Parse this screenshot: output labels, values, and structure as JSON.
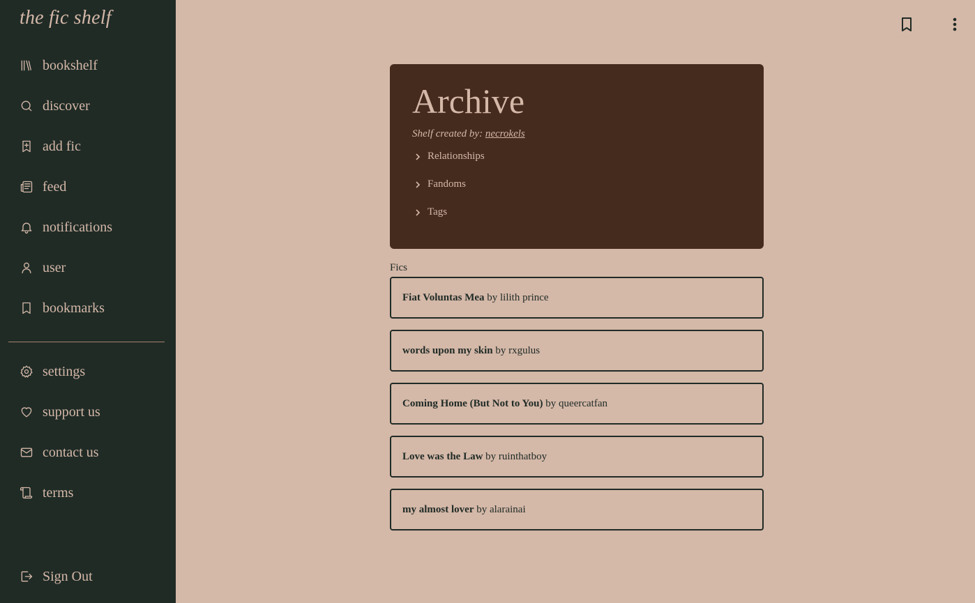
{
  "sidebar": {
    "brand": "the fic shelf",
    "items": [
      {
        "label": "bookshelf",
        "icon": "library-icon"
      },
      {
        "label": "discover",
        "icon": "search-icon"
      },
      {
        "label": "add fic",
        "icon": "bookmark-plus-icon"
      },
      {
        "label": "feed",
        "icon": "newspaper-icon"
      },
      {
        "label": "notifications",
        "icon": "bell-icon"
      },
      {
        "label": "user",
        "icon": "user-icon"
      },
      {
        "label": "bookmarks",
        "icon": "bookmark-icon"
      }
    ],
    "secondary": [
      {
        "label": "settings",
        "icon": "gear-icon"
      },
      {
        "label": "support us",
        "icon": "heart-icon"
      },
      {
        "label": "contact us",
        "icon": "mail-icon"
      },
      {
        "label": "terms",
        "icon": "scroll-icon"
      }
    ],
    "sign_out": {
      "label": "Sign Out",
      "icon": "log-out-icon"
    }
  },
  "header": {
    "bookmark_icon": "bookmark-icon",
    "menu_icon": "more-vertical-icon"
  },
  "shelf": {
    "title": "Archive",
    "created_by_prefix": "Shelf created by:",
    "creator": "necrokels",
    "sections": [
      "Relationships",
      "Fandoms",
      "Tags"
    ]
  },
  "fics": {
    "label": "Fics",
    "items": [
      {
        "title": "Fiat Voluntas Mea",
        "by": "by",
        "author": "lilith prince"
      },
      {
        "title": "words upon my skin",
        "by": "by",
        "author": "rxgulus"
      },
      {
        "title": "Coming Home (But Not to You)",
        "by": "by",
        "author": "queercatfan"
      },
      {
        "title": "Love was the Law",
        "by": "by",
        "author": "ruinthatboy"
      },
      {
        "title": "my almost lover",
        "by": "by",
        "author": "alarainai"
      }
    ]
  },
  "colors": {
    "sidebar_bg": "#202b26",
    "page_bg": "#d4b8a8",
    "card_bg": "#452b1e",
    "text_light": "#d4b8a8",
    "text_dark": "#1f2a25"
  }
}
